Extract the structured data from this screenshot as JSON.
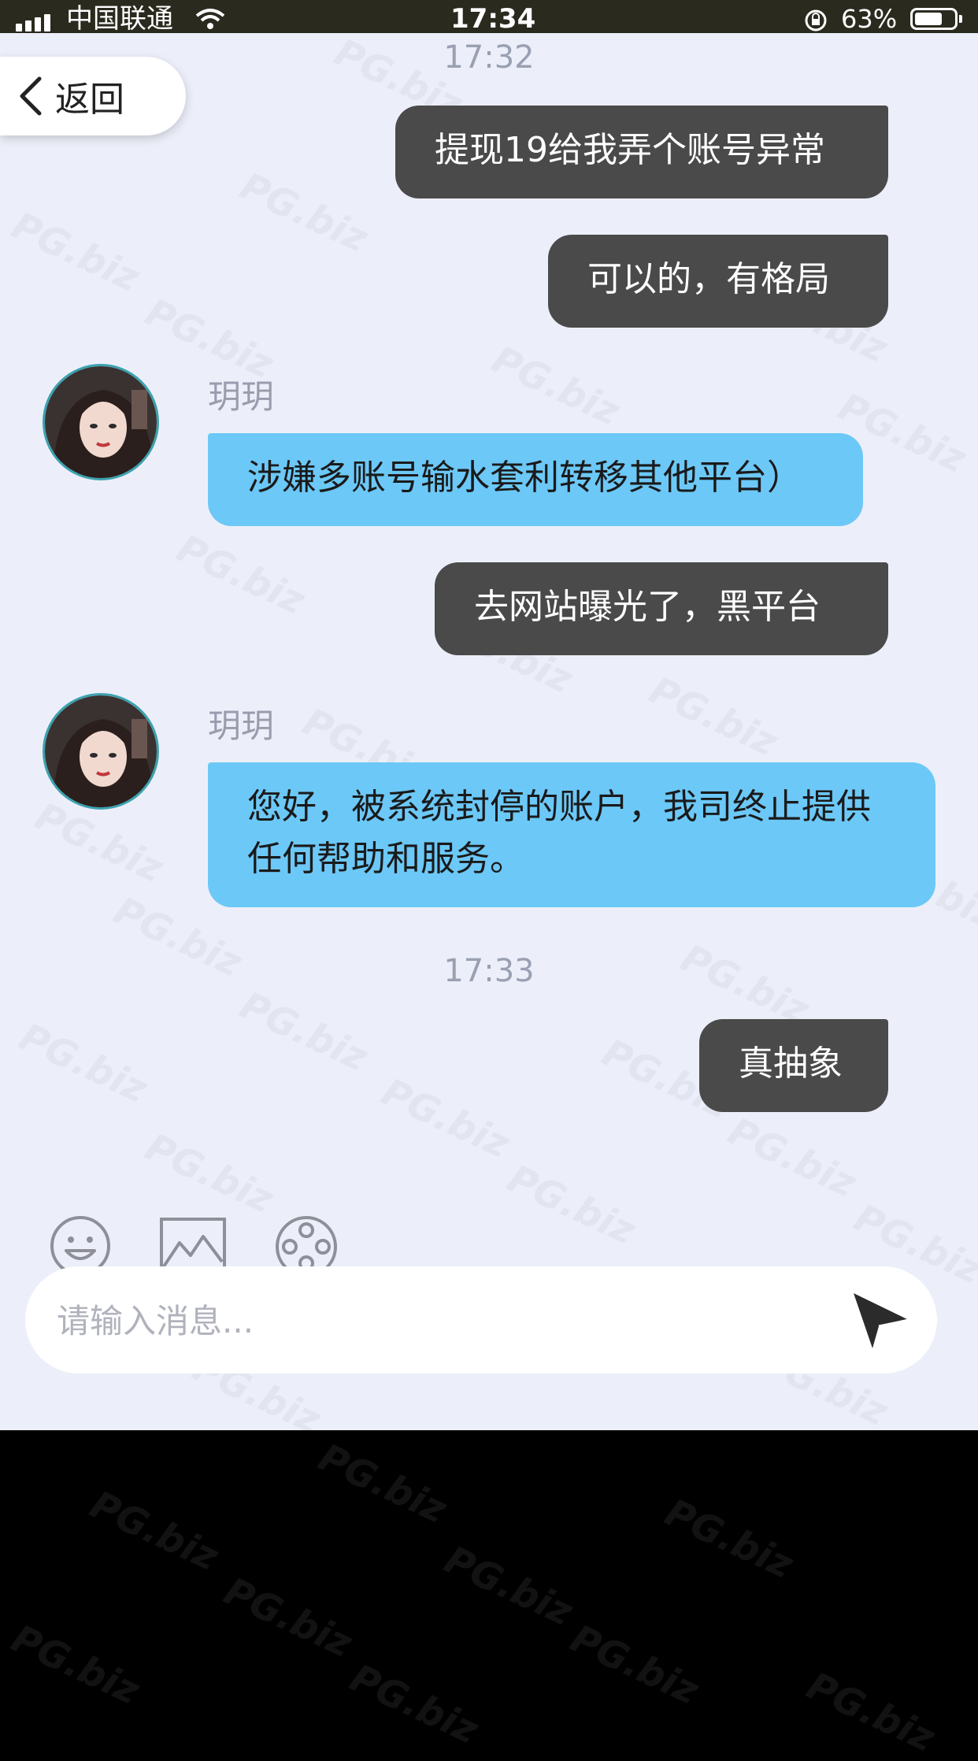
{
  "status_bar": {
    "carrier": "中国联通",
    "time": "17:34",
    "battery_percent": "63%",
    "icons": [
      "signal-icon",
      "wifi-icon",
      "orientation-lock-icon",
      "battery-icon"
    ]
  },
  "header": {
    "back_label": "返回",
    "back_icon": "chevron-left-icon"
  },
  "messages": [
    {
      "type": "time",
      "text": "17:32"
    },
    {
      "type": "out",
      "text": "提现19给我弄个账号异常"
    },
    {
      "type": "out",
      "text": "可以的，有格局"
    },
    {
      "type": "in",
      "sender": "玥玥",
      "text": "涉嫌多账号输水套利转移其他平台）"
    },
    {
      "type": "out",
      "text": "去网站曝光了，黑平台"
    },
    {
      "type": "in",
      "sender": "玥玥",
      "text": "您好，被系统封停的账户，我司终止提供任何帮助和服务。"
    },
    {
      "type": "time",
      "text": "17:33"
    },
    {
      "type": "out",
      "text": "真抽象"
    }
  ],
  "toolbar": {
    "icons": [
      "emoji-icon",
      "image-icon",
      "video-reel-icon"
    ]
  },
  "composer": {
    "placeholder": "请输入消息...",
    "value": "",
    "send_icon": "send-icon"
  },
  "watermark": {
    "text": "PG.biz"
  },
  "colors": {
    "outgoing_bubble": "#4a4a4a",
    "incoming_bubble": "#6cc8f7",
    "chat_bg": "#eceff9"
  }
}
